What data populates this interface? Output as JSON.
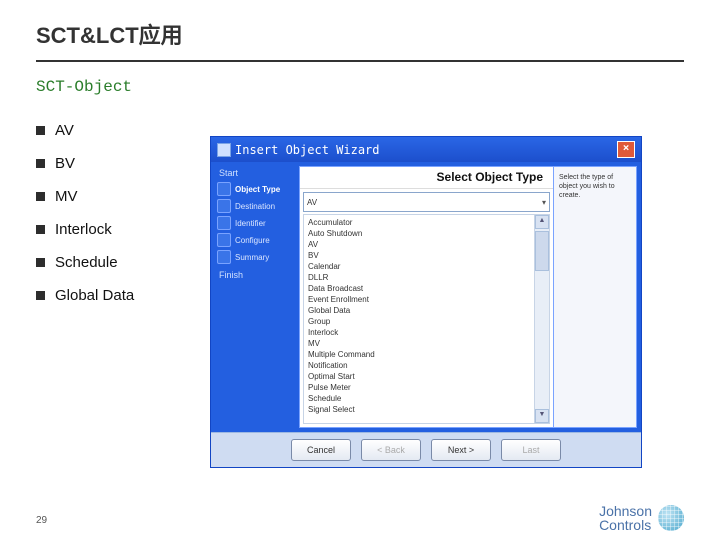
{
  "title": "SCT&LCT应用",
  "subtitle": "SCT-Object",
  "bullets": [
    "AV",
    "BV",
    "MV",
    "Interlock",
    "Schedule",
    "Global Data"
  ],
  "dialog": {
    "caption": "Insert Object Wizard",
    "header": "Select Object Type",
    "start": "Start",
    "finish": "Finish",
    "steps": [
      "Object Type",
      "Destination",
      "Identifier",
      "Configure",
      "Summary"
    ],
    "selected": "AV",
    "list": [
      "Accumulator",
      "Auto Shutdown",
      "AV",
      "BV",
      "Calendar",
      "DLLR",
      "Data Broadcast",
      "Event Enrollment",
      "Global Data",
      "Group",
      "Interlock",
      "MV",
      "Multiple Command",
      "Notification",
      "Optimal Start",
      "Pulse Meter",
      "Schedule",
      "Signal Select"
    ],
    "help": "Select the type of object you wish to create.",
    "buttons": {
      "cancel": "Cancel",
      "back": "< Back",
      "next": "Next >",
      "last": "Last"
    }
  },
  "page": "29",
  "brand": {
    "line1": "Johnson",
    "line2": "Controls"
  }
}
